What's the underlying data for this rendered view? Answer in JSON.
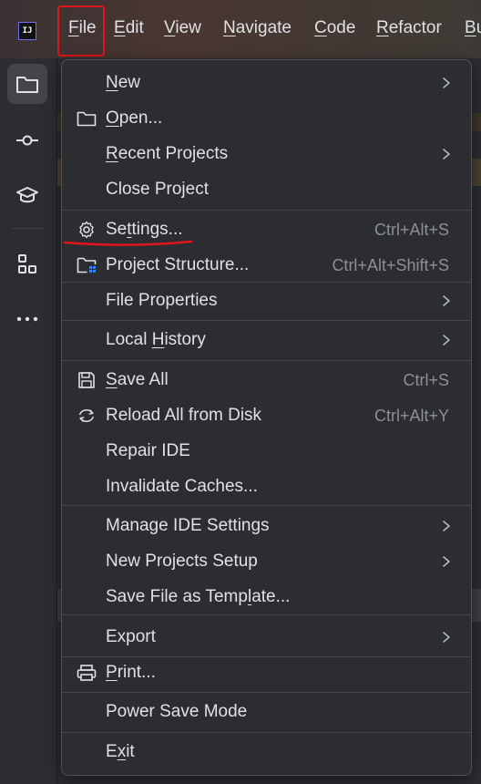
{
  "app": {
    "logo_text": "IJ"
  },
  "menubar": {
    "items": [
      {
        "label": "File",
        "mnemonic_index": 0
      },
      {
        "label": "Edit",
        "mnemonic_index": 0
      },
      {
        "label": "View",
        "mnemonic_index": 0
      },
      {
        "label": "Navigate",
        "mnemonic_index": 0
      },
      {
        "label": "Code",
        "mnemonic_index": 0
      },
      {
        "label": "Refactor",
        "mnemonic_index": 0
      },
      {
        "label": "Bu",
        "mnemonic_index": 0
      }
    ]
  },
  "toolstrip": {
    "items": [
      {
        "icon": "folder-icon",
        "active": true
      },
      {
        "icon": "commit-icon"
      },
      {
        "icon": "graduation-cap-icon"
      },
      {
        "icon": "structure-icon"
      },
      {
        "icon": "more-icon"
      }
    ]
  },
  "file_menu": {
    "items": [
      {
        "pre": "",
        "mn": "N",
        "post": "ew",
        "shortcut": "",
        "submenu": true,
        "icon": ""
      },
      {
        "pre": "",
        "mn": "O",
        "post": "pen...",
        "shortcut": "",
        "submenu": false,
        "icon": "folder-icon"
      },
      {
        "pre": "",
        "mn": "R",
        "post": "ecent Projects",
        "shortcut": "",
        "submenu": true,
        "icon": ""
      },
      {
        "pre": "Close Pro",
        "mn": "j",
        "post": "ect",
        "shortcut": "",
        "submenu": false,
        "icon": ""
      },
      {
        "pre": "Se",
        "mn": "t",
        "post": "tings...",
        "shortcut": "Ctrl+Alt+S",
        "submenu": false,
        "icon": "gear-icon"
      },
      {
        "pre": "Project Structure...",
        "mn": "",
        "post": "",
        "shortcut": "Ctrl+Alt+Shift+S",
        "submenu": false,
        "icon": "project-structure-icon"
      },
      {
        "pre": "File Properties",
        "mn": "",
        "post": "",
        "shortcut": "",
        "submenu": true,
        "icon": ""
      },
      {
        "pre": "Local ",
        "mn": "H",
        "post": "istory",
        "shortcut": "",
        "submenu": true,
        "icon": ""
      },
      {
        "pre": "",
        "mn": "S",
        "post": "ave All",
        "shortcut": "Ctrl+S",
        "submenu": false,
        "icon": "save-icon"
      },
      {
        "pre": "Reload All from Disk",
        "mn": "",
        "post": "",
        "shortcut": "Ctrl+Alt+Y",
        "submenu": false,
        "icon": "reload-icon"
      },
      {
        "pre": "Repair IDE",
        "mn": "",
        "post": "",
        "shortcut": "",
        "submenu": false,
        "icon": ""
      },
      {
        "pre": "Invalidate Caches...",
        "mn": "",
        "post": "",
        "shortcut": "",
        "submenu": false,
        "icon": ""
      },
      {
        "pre": "Manage IDE Settings",
        "mn": "",
        "post": "",
        "shortcut": "",
        "submenu": true,
        "icon": ""
      },
      {
        "pre": "New Projects Setup",
        "mn": "",
        "post": "",
        "shortcut": "",
        "submenu": true,
        "icon": ""
      },
      {
        "pre": "Save File as Temp",
        "mn": "l",
        "post": "ate...",
        "shortcut": "",
        "submenu": false,
        "icon": ""
      },
      {
        "pre": "Export",
        "mn": "",
        "post": "",
        "shortcut": "",
        "submenu": true,
        "icon": ""
      },
      {
        "pre": "",
        "mn": "P",
        "post": "rint...",
        "shortcut": "",
        "submenu": false,
        "icon": "printer-icon"
      },
      {
        "pre": "Power Save Mode",
        "mn": "",
        "post": "",
        "shortcut": "",
        "submenu": false,
        "icon": ""
      },
      {
        "pre": "E",
        "mn": "x",
        "post": "it",
        "shortcut": "",
        "submenu": false,
        "icon": ""
      }
    ]
  },
  "colors": {
    "annotation": "#e0141c",
    "menu_bg": "#2b2d30",
    "text": "#dfe1e5",
    "shortcut": "#8c8f94"
  }
}
